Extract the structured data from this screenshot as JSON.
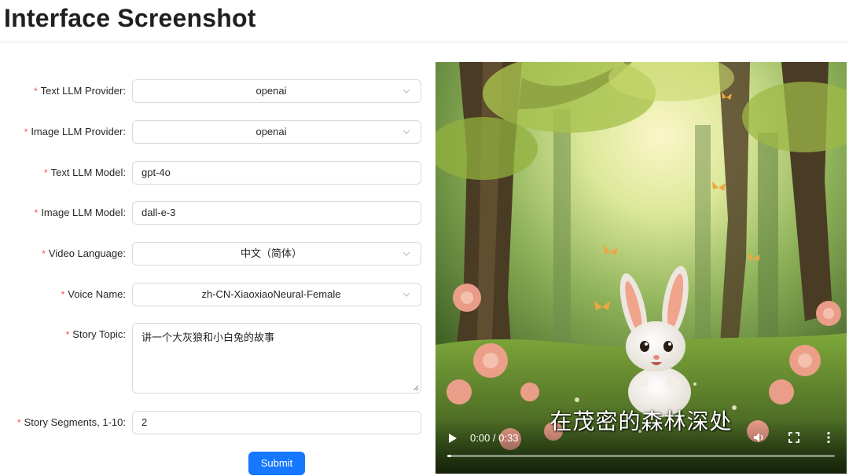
{
  "page": {
    "title": "Interface Screenshot"
  },
  "form": {
    "text_llm_provider": {
      "label": "Text LLM Provider",
      "value": "openai"
    },
    "image_llm_provider": {
      "label": "Image LLM Provider",
      "value": "openai"
    },
    "text_llm_model": {
      "label": "Text LLM Model",
      "value": "gpt-4o"
    },
    "image_llm_model": {
      "label": "Image LLM Model",
      "value": "dall-e-3"
    },
    "video_language": {
      "label": "Video Language",
      "value": "中文（简体）"
    },
    "voice_name": {
      "label": "Voice Name",
      "value": "zh-CN-XiaoxiaoNeural-Female"
    },
    "story_topic": {
      "label": "Story Topic",
      "value": "讲一个大灰狼和小白兔的故事"
    },
    "story_segments": {
      "label": "Story Segments, 1-10",
      "value": "2"
    },
    "label_suffix": ":",
    "required_mark": "*",
    "submit_label": "Submit"
  },
  "video": {
    "subtitle": "在茂密的森林深处",
    "time": "0:00 / 0:33",
    "progress": 0.0,
    "icons": [
      "play-icon",
      "volume-icon",
      "fullscreen-icon",
      "more-options-icon"
    ]
  },
  "colors": {
    "accent": "#1677ff",
    "required": "#ff4d4f",
    "border": "#d9d9d9"
  }
}
